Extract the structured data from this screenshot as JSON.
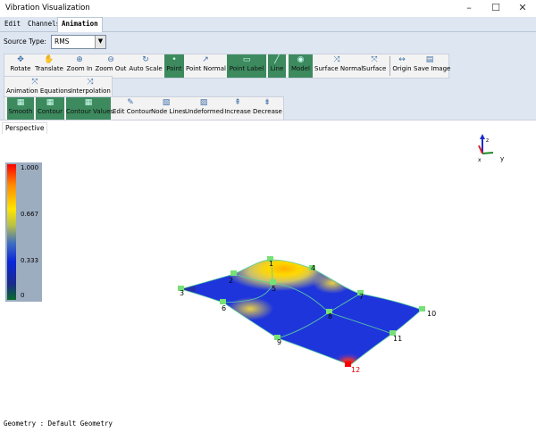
{
  "window": {
    "title": "Vibration Visualization",
    "minimize": "–",
    "maximize": "☐",
    "close": "✕"
  },
  "menu": {
    "items": [
      {
        "label": "Edit"
      },
      {
        "label": "Channels"
      },
      {
        "label": "Animation"
      }
    ]
  },
  "source": {
    "label": "Source Type:",
    "value": "RMS"
  },
  "toolbar1": [
    {
      "label": "Rotate",
      "icon": "✥"
    },
    {
      "label": "Translate",
      "icon": "✋"
    },
    {
      "label": "Zoom In",
      "icon": "⊕"
    },
    {
      "label": "Zoom Out",
      "icon": "⊖"
    },
    {
      "label": "Auto Scale",
      "icon": "↻"
    },
    {
      "label": "Point",
      "icon": "•"
    },
    {
      "label": "Point Normal",
      "icon": "↗"
    },
    {
      "label": "Point Label",
      "icon": "▭"
    },
    {
      "label": "Line",
      "icon": "╱"
    },
    {
      "label": "Model",
      "icon": "◉"
    },
    {
      "label": "Surface Normal",
      "icon": "⤨"
    },
    {
      "label": "Surface",
      "icon": "⤧"
    },
    {
      "label": "Origin",
      "icon": "↔"
    },
    {
      "label": "Save Image",
      "icon": "▤"
    }
  ],
  "toolbar2": [
    {
      "label": "Animation Equations",
      "icon": "⤧"
    },
    {
      "label": "Interpolation",
      "icon": "⤨"
    }
  ],
  "toolbar3": [
    {
      "label": "Smooth",
      "icon": "▦"
    },
    {
      "label": "Contour",
      "icon": "▦"
    },
    {
      "label": "Contour Values",
      "icon": "▦"
    },
    {
      "label": "Edit Contour",
      "icon": "✎"
    },
    {
      "label": "Node Lines",
      "icon": "▧"
    },
    {
      "label": "Undeformed",
      "icon": "▨"
    },
    {
      "label": "Increase",
      "icon": "⇞"
    },
    {
      "label": "Decrease",
      "icon": "⇟"
    }
  ],
  "viewport": {
    "tab": "Perspective",
    "status": "Geometry : Default Geometry"
  },
  "legend": {
    "ticks": [
      "1.000",
      "0.667",
      "0.333",
      "0"
    ]
  },
  "axes": {
    "x": "x",
    "y": "y",
    "z": "z"
  },
  "nodes": [
    "1",
    "2",
    "3",
    "4",
    "5",
    "6",
    "7",
    "8",
    "9",
    "10",
    "11",
    "12"
  ]
}
